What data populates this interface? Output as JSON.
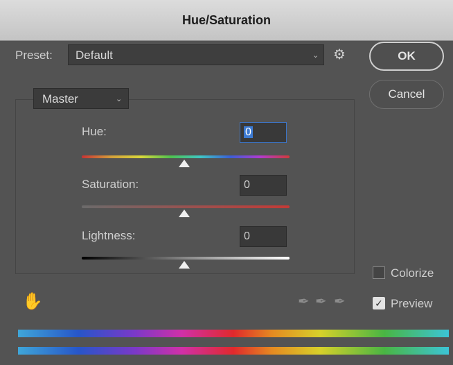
{
  "window": {
    "title": "Hue/Saturation"
  },
  "preset": {
    "label": "Preset:",
    "value": "Default"
  },
  "buttons": {
    "ok": "OK",
    "cancel": "Cancel"
  },
  "channel": {
    "value": "Master"
  },
  "sliders": {
    "hue": {
      "label": "Hue:",
      "value": "0"
    },
    "saturation": {
      "label": "Saturation:",
      "value": "0"
    },
    "lightness": {
      "label": "Lightness:",
      "value": "0"
    }
  },
  "options": {
    "colorize": {
      "label": "Colorize",
      "checked": false
    },
    "preview": {
      "label": "Preview",
      "checked": true
    }
  },
  "icons": {
    "settings": "gear-icon",
    "target_adjust": "hand-target-icon",
    "droppers": [
      "eyedropper-icon",
      "eyedropper-plus-icon",
      "eyedropper-minus-icon"
    ]
  }
}
